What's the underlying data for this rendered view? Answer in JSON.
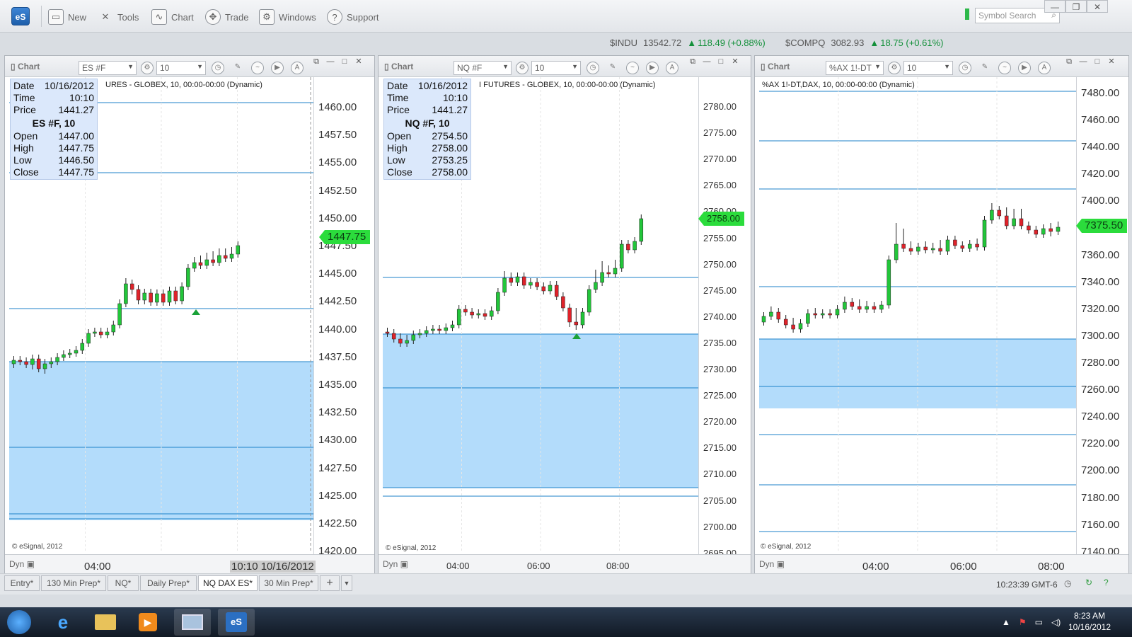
{
  "app": {
    "logo": "eS"
  },
  "toolbar": {
    "new": "New",
    "tools": "Tools",
    "chart": "Chart",
    "trade": "Trade",
    "windows": "Windows",
    "support": "Support",
    "search_placeholder": "Symbol Search"
  },
  "tickers": [
    {
      "sym": "$INDU",
      "val": "13542.72",
      "chg": "118.49 (+0.88%)"
    },
    {
      "sym": "$COMPQ",
      "val": "3082.93",
      "chg": "18.75 (+0.61%)"
    }
  ],
  "charts": [
    {
      "title": "Chart",
      "symbol": "ES #F",
      "interval": "10",
      "caption": "URES - GLOBEX, 10, 00:00-00:00 (Dynamic)",
      "info": {
        "date_l": "Date",
        "date": "10/16/2012",
        "time_l": "Time",
        "time": "10:10",
        "price_l": "Price",
        "price": "1441.27",
        "head": "ES #F, 10",
        "open_l": "Open",
        "open": "1447.00",
        "high_l": "High",
        "high": "1447.75",
        "low_l": "Low",
        "low": "1446.50",
        "close_l": "Close",
        "close": "1447.75"
      },
      "last": "1447.75",
      "yticks": [
        "1460.00",
        "1457.50",
        "1455.00",
        "1452.50",
        "1450.00",
        "1447.50",
        "1445.00",
        "1442.50",
        "1440.00",
        "1437.50",
        "1435.00",
        "1432.50",
        "1430.00",
        "1427.50",
        "1425.00",
        "1422.50",
        "1420.00"
      ],
      "xticks": [
        "04:00"
      ],
      "xcursor": "10:10 10/16/2012",
      "copyright": "© eSignal, 2012",
      "dyn": "Dyn"
    },
    {
      "title": "Chart",
      "symbol": "NQ #F",
      "interval": "10",
      "caption": "I FUTURES - GLOBEX, 10, 00:00-00:00 (Dynamic)",
      "info": {
        "date_l": "Date",
        "date": "10/16/2012",
        "time_l": "Time",
        "time": "10:10",
        "price_l": "Price",
        "price": "1441.27",
        "head": "NQ #F, 10",
        "open_l": "Open",
        "open": "2754.50",
        "high_l": "High",
        "high": "2758.00",
        "low_l": "Low",
        "low": "2753.25",
        "close_l": "Close",
        "close": "2758.00"
      },
      "last": "2758.00",
      "yticks": [
        "2780.00",
        "2775.00",
        "2770.00",
        "2765.00",
        "2760.00",
        "2755.00",
        "2750.00",
        "2745.00",
        "2740.00",
        "2735.00",
        "2730.00",
        "2725.00",
        "2720.00",
        "2715.00",
        "2710.00",
        "2705.00",
        "2700.00",
        "2695.00"
      ],
      "xticks": [
        "04:00",
        "06:00",
        "08:00"
      ],
      "copyright": "© eSignal, 2012",
      "dyn": "Dyn"
    },
    {
      "title": "Chart",
      "symbol": "%AX 1!-DT",
      "interval": "10",
      "caption": "%AX 1!-DT,DAX, 10, 00:00-00:00 (Dynamic)",
      "last": "7375.50",
      "yticks": [
        "7480.00",
        "7460.00",
        "7440.00",
        "7420.00",
        "7400.00",
        "7380.00",
        "7360.00",
        "7340.00",
        "7320.00",
        "7300.00",
        "7280.00",
        "7260.00",
        "7240.00",
        "7220.00",
        "7200.00",
        "7180.00",
        "7160.00",
        "7140.00"
      ],
      "xticks": [
        "04:00",
        "06:00",
        "08:00"
      ],
      "copyright": "© eSignal, 2012",
      "dyn": "Dyn"
    }
  ],
  "tabs": [
    "Entry*",
    "130 Min Prep*",
    "NQ*",
    "Daily Prep*",
    "NQ DAX ES*",
    "30 Min Prep*"
  ],
  "active_tab": "NQ DAX ES*",
  "status_clock": "10:23:39 GMT-6",
  "taskbar": {
    "time": "8:23 AM",
    "date": "10/16/2012"
  },
  "colors": {
    "up": "#22c63a",
    "down": "#e0222a",
    "zone": "#b3dcfb",
    "line": "#1e82c8"
  }
}
